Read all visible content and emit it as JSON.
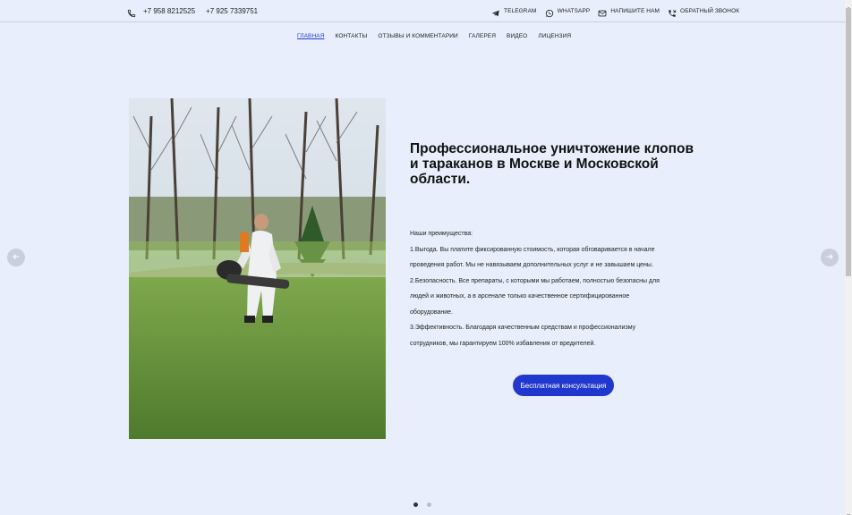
{
  "topbar": {
    "phone_icon": "phone-icon",
    "phones": [
      "+7 958 8212525",
      "+7 925 7339751"
    ],
    "contacts": [
      {
        "icon": "telegram-icon",
        "label": "TELEGRAM"
      },
      {
        "icon": "whatsapp-icon",
        "label": "WHATSAPP"
      },
      {
        "icon": "mail-icon",
        "label": "НАПИШИТЕ НАМ"
      },
      {
        "icon": "callback-phone-icon",
        "label": "ОБРАТНЫЙ ЗВОНОК"
      }
    ]
  },
  "nav": {
    "items": [
      "ГЛАВНАЯ",
      "КОНТАКТЫ",
      "ОТЗЫВЫ И КОММЕНТАРИИ",
      "ГАЛЕРЕЯ",
      "ВИДЕО",
      "ЛИЦЕНЗИЯ"
    ],
    "active": "ГЛАВНАЯ"
  },
  "hero": {
    "title": "Профессиональное уничтожение клопов и тараканов в Москве и Московской области.",
    "benefits": [
      "Наши преимущества:",
      "1.Выгода. Вы платите фиксированную стоимость, которая обговаривается в начале",
      "проведения работ. Мы не навязываем дополнительных услуг и не завышаем цены.",
      "2.Безопасность. Все препараты, с которыми мы работаем, полностью безопасны для",
      "людей и животных, а в арсенале только качественное сертифицированное",
      "оборудование.",
      "3.Эффективность. Благодаря качественным средствам и профессионализму",
      "сотрудников, мы гарантируем 100% избавления от вредителей."
    ],
    "cta_label": "Бесплатная консультация"
  },
  "slider": {
    "prev_icon": "arrow-left-icon",
    "next_icon": "arrow-right-icon",
    "slides_count": 2,
    "active_slide": 1
  },
  "colors": {
    "background": "#e8eefb",
    "accent": "#2138cf",
    "nav_active": "#1f3fd6"
  }
}
